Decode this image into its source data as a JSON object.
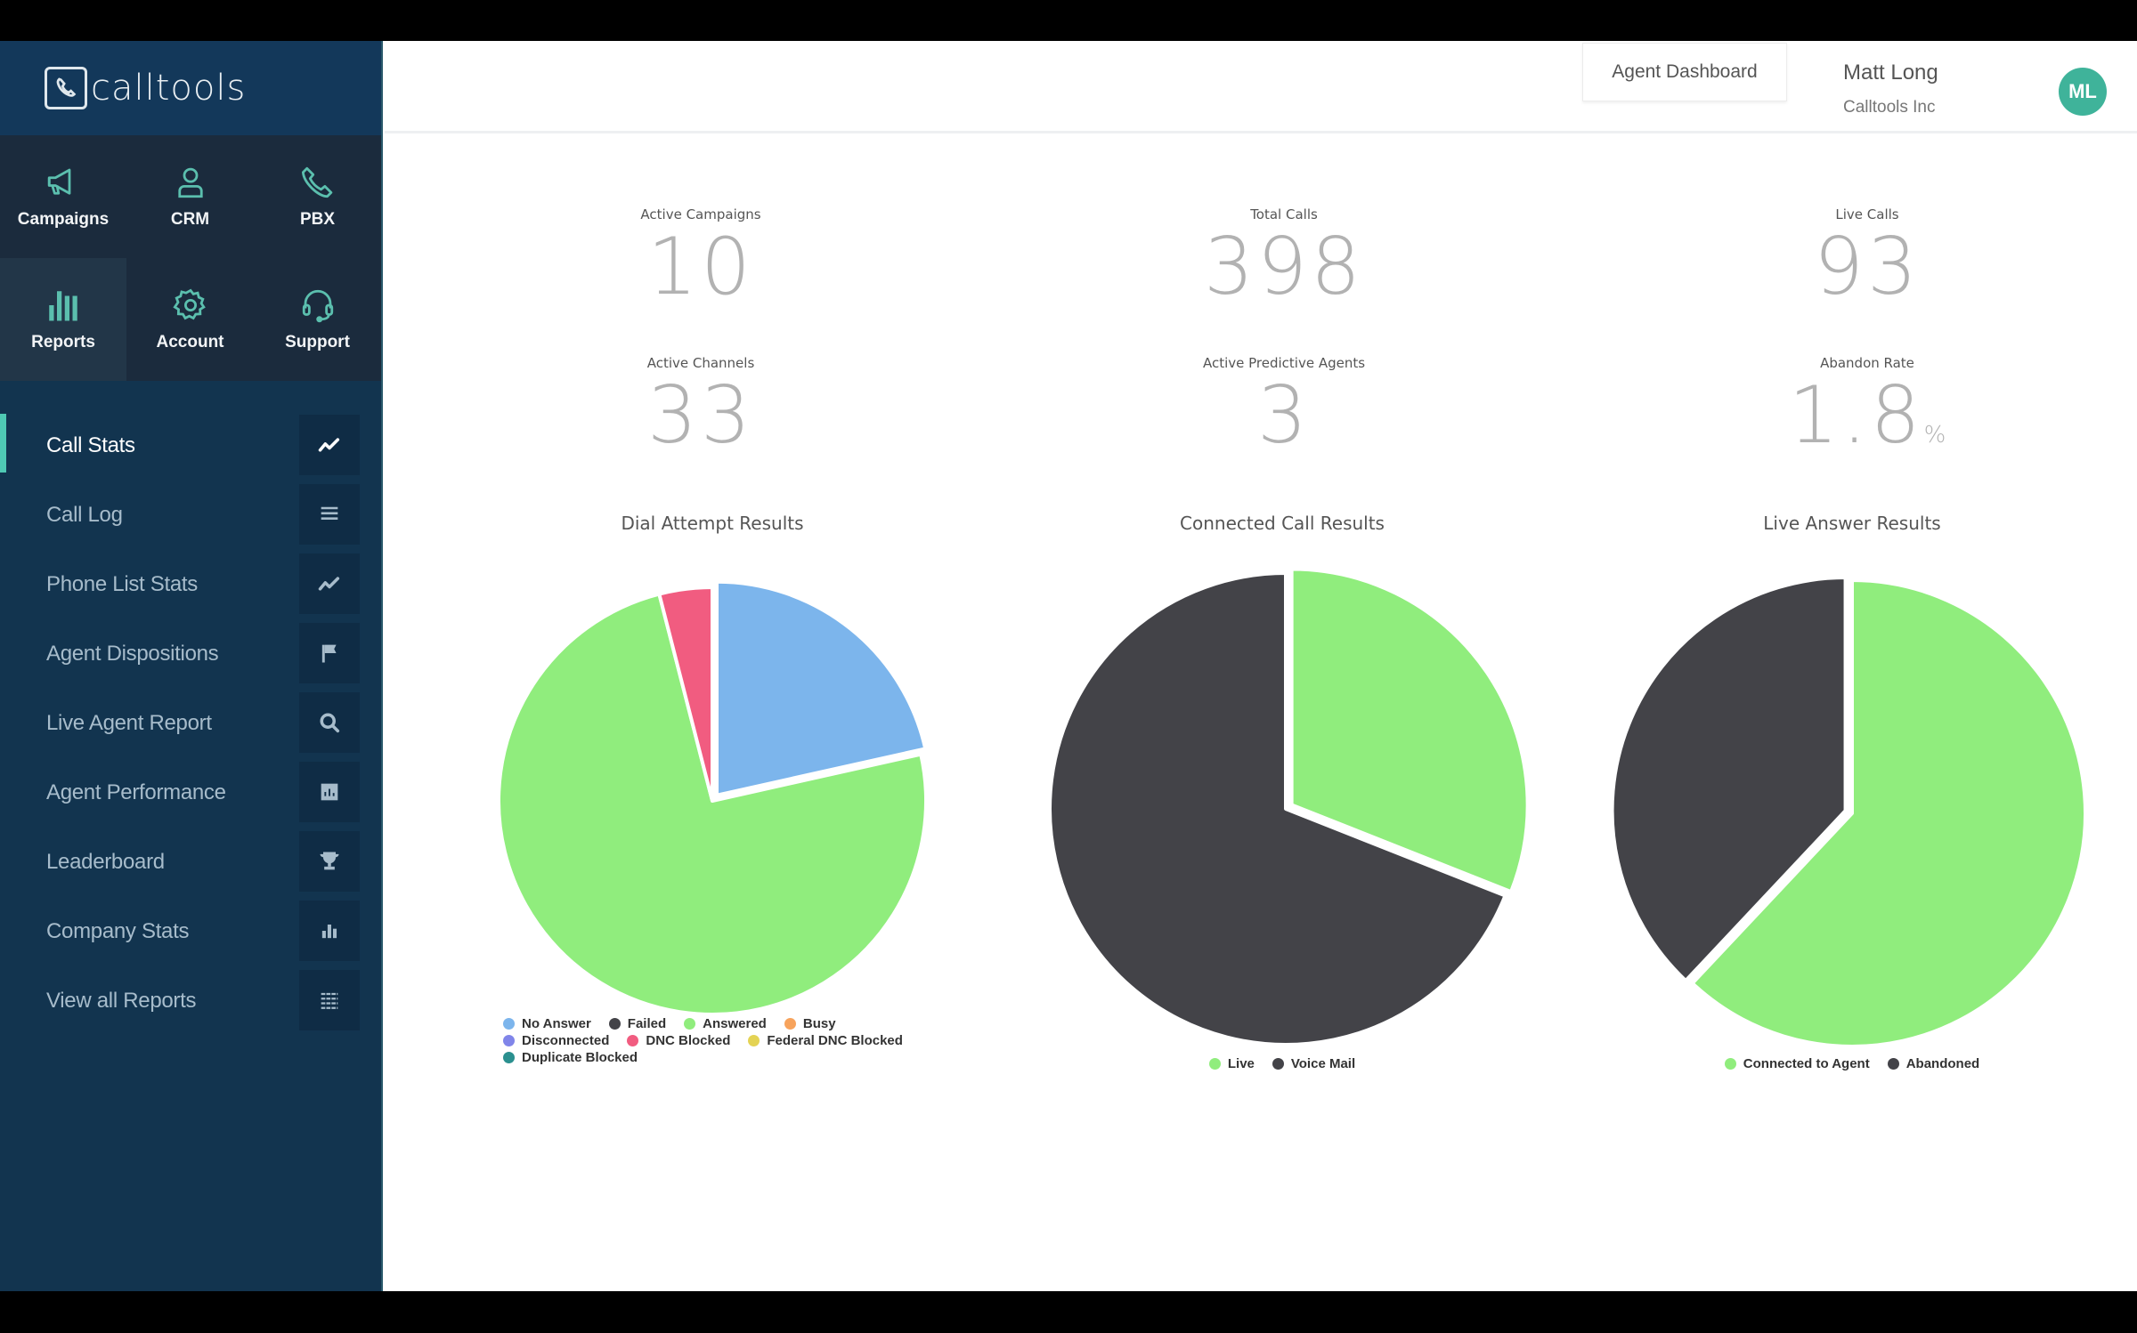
{
  "brand": {
    "name": "calltools"
  },
  "modules": [
    {
      "label": "Campaigns",
      "icon": "megaphone-icon",
      "active": false
    },
    {
      "label": "CRM",
      "icon": "person-icon",
      "active": false
    },
    {
      "label": "PBX",
      "icon": "phone-icon",
      "active": false
    },
    {
      "label": "Reports",
      "icon": "bar-chart-icon",
      "active": true
    },
    {
      "label": "Account",
      "icon": "gear-icon",
      "active": false
    },
    {
      "label": "Support",
      "icon": "headset-icon",
      "active": false
    }
  ],
  "nav": [
    {
      "label": "Call Stats",
      "icon": "trend-line-icon",
      "active": true
    },
    {
      "label": "Call Log",
      "icon": "list-icon",
      "active": false
    },
    {
      "label": "Phone List Stats",
      "icon": "trend-line-icon",
      "active": false
    },
    {
      "label": "Agent Dispositions",
      "icon": "flag-icon",
      "active": false
    },
    {
      "label": "Live Agent Report",
      "icon": "search-icon",
      "active": false
    },
    {
      "label": "Agent Performance",
      "icon": "chart-box-icon",
      "active": false
    },
    {
      "label": "Leaderboard",
      "icon": "trophy-icon",
      "active": false
    },
    {
      "label": "Company Stats",
      "icon": "bar-chart-icon",
      "active": false
    },
    {
      "label": "View all Reports",
      "icon": "table-list-icon",
      "active": false
    }
  ],
  "header": {
    "agent_dashboard_label": "Agent Dashboard",
    "user_name": "Matt Long",
    "user_company": "Calltools Inc",
    "avatar_initials": "ML"
  },
  "stats": [
    {
      "label": "Active Campaigns",
      "value": "10",
      "unit": ""
    },
    {
      "label": "Total Calls",
      "value": "398",
      "unit": ""
    },
    {
      "label": "Live Calls",
      "value": "93",
      "unit": ""
    },
    {
      "label": "Active Channels",
      "value": "33",
      "unit": ""
    },
    {
      "label": "Active Predictive Agents",
      "value": "3",
      "unit": ""
    },
    {
      "label": "Abandon Rate",
      "value": "1.8",
      "unit": "%"
    }
  ],
  "chart_data": [
    {
      "type": "pie",
      "title": "Dial Attempt Results",
      "legend": [
        {
          "name": "No Answer",
          "color": "#7cb5ec"
        },
        {
          "name": "Failed",
          "color": "#434348"
        },
        {
          "name": "Answered",
          "color": "#90ed7d"
        },
        {
          "name": "Busy",
          "color": "#f7a35c"
        },
        {
          "name": "Disconnected",
          "color": "#8085e9"
        },
        {
          "name": "DNC Blocked",
          "color": "#f15c80"
        },
        {
          "name": "Federal DNC Blocked",
          "color": "#e4d354"
        },
        {
          "name": "Duplicate Blocked",
          "color": "#2b908f"
        }
      ],
      "series": [
        {
          "name": "No Answer",
          "value": 21.5,
          "color": "#7cb5ec"
        },
        {
          "name": "Failed",
          "value": 0,
          "color": "#434348"
        },
        {
          "name": "Answered",
          "value": 74.5,
          "color": "#90ed7d"
        },
        {
          "name": "Busy",
          "value": 0,
          "color": "#f7a35c"
        },
        {
          "name": "Disconnected",
          "value": 0,
          "color": "#8085e9"
        },
        {
          "name": "DNC Blocked",
          "value": 4,
          "color": "#f15c80"
        },
        {
          "name": "Federal DNC Blocked",
          "value": 0,
          "color": "#e4d354"
        },
        {
          "name": "Duplicate Blocked",
          "value": 0,
          "color": "#2b908f"
        }
      ],
      "exploded": [
        "No Answer"
      ],
      "legend_position": "bottom"
    },
    {
      "type": "pie",
      "title": "Connected Call Results",
      "legend": [
        {
          "name": "Live",
          "color": "#90ed7d"
        },
        {
          "name": "Voice Mail",
          "color": "#434348"
        }
      ],
      "series": [
        {
          "name": "Live",
          "value": 31,
          "color": "#90ed7d"
        },
        {
          "name": "Voice Mail",
          "value": 69,
          "color": "#434348"
        }
      ],
      "exploded": [
        "Live"
      ],
      "legend_position": "bottom"
    },
    {
      "type": "pie",
      "title": "Live Answer Results",
      "legend": [
        {
          "name": "Connected to Agent",
          "color": "#90ed7d"
        },
        {
          "name": "Abandoned",
          "color": "#434348"
        }
      ],
      "series": [
        {
          "name": "Connected to Agent",
          "value": 62,
          "color": "#90ed7d"
        },
        {
          "name": "Abandoned",
          "value": 38,
          "color": "#434348"
        }
      ],
      "exploded": [
        "Abandoned"
      ],
      "legend_position": "bottom"
    }
  ]
}
